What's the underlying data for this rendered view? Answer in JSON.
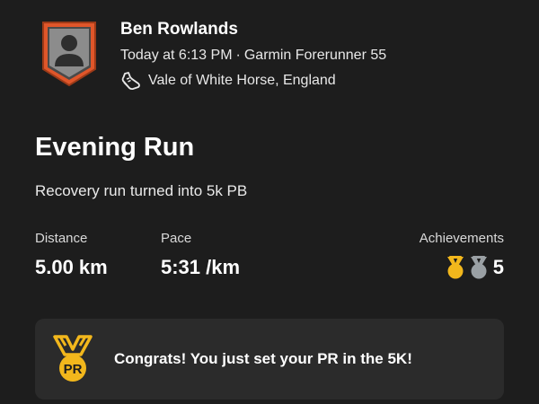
{
  "athlete": {
    "name": "Ben Rowlands",
    "avatar_icon": "athlete-badge-icon"
  },
  "meta": {
    "time": "Today at 6:13 PM",
    "separator": "·",
    "device": "Garmin Forerunner 55",
    "location": "Vale of White Horse, England",
    "location_icon": "running-shoe-icon"
  },
  "activity": {
    "title": "Evening Run",
    "description": "Recovery run turned into 5k PB"
  },
  "stats": {
    "distance": {
      "label": "Distance",
      "value": "5.00 km"
    },
    "pace": {
      "label": "Pace",
      "value": "5:31 /km"
    },
    "achievements": {
      "label": "Achievements",
      "count": "5"
    }
  },
  "pr_card": {
    "badge_text": "PR",
    "message": "Congrats! You just set your PR in the 5K!"
  },
  "colors": {
    "background": "#1d1d1d",
    "card": "#2b2b2b",
    "badge_orange": "#e0562a",
    "gold": "#f2b71c",
    "silver": "#9aa0a4"
  }
}
